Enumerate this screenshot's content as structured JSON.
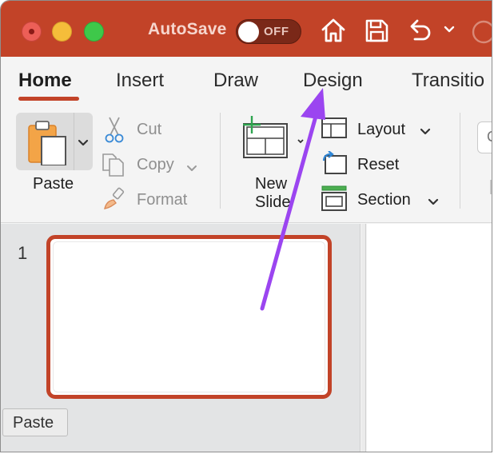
{
  "titlebar": {
    "autosave_label": "AutoSave",
    "toggle_state": "OFF",
    "accent_color": "#c24328"
  },
  "tabs": [
    {
      "label": "Home",
      "active": true
    },
    {
      "label": "Insert",
      "active": false
    },
    {
      "label": "Draw",
      "active": false
    },
    {
      "label": "Design",
      "active": false
    },
    {
      "label": "Transitio",
      "active": false
    }
  ],
  "clipboard": {
    "paste_label": "Paste",
    "cut_label": "Cut",
    "copy_label": "Copy",
    "format_label": "Format"
  },
  "slides_group": {
    "new_slide_line1": "New",
    "new_slide_line2": "Slide",
    "layout_label": "Layout",
    "reset_label": "Reset",
    "section_label": "Section"
  },
  "side_field_text": "C",
  "thumbnails": [
    {
      "number": "1"
    }
  ],
  "tooltip": "Paste",
  "annotation": {
    "arrow_color": "#9b45f0",
    "arrow_target": "Design"
  }
}
